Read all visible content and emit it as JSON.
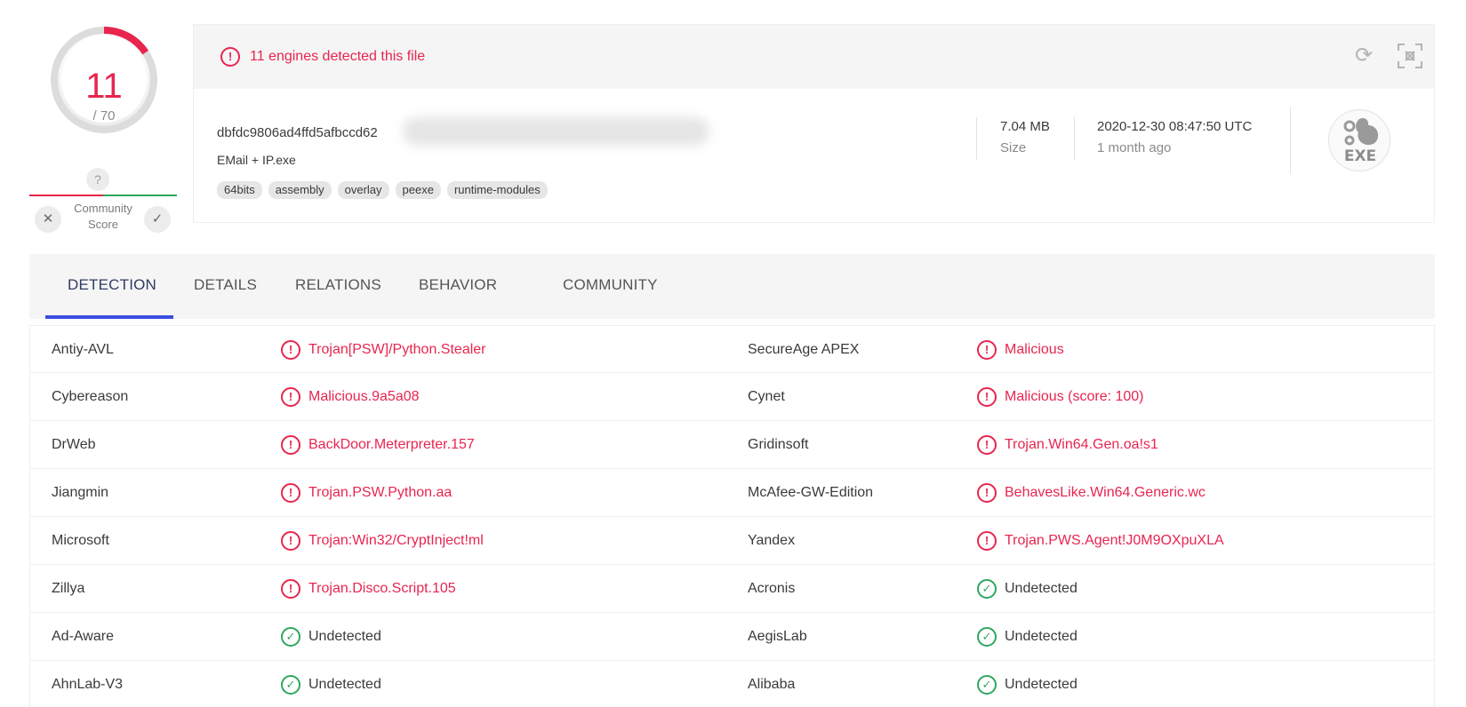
{
  "score": {
    "detected": "11",
    "total": "/ 70",
    "detected_fraction": 0.157,
    "community_question": "?",
    "community_label_1": "Community",
    "community_label_2": "Score",
    "vote_down": "✕",
    "vote_up": "✓"
  },
  "banner": {
    "alert_icon": "!",
    "message": "11 engines detected this file"
  },
  "file": {
    "hash_visible": "dbfdc9806ad4ffd5afbccd62",
    "name": "EMail + IP.exe",
    "tags": [
      "64bits",
      "assembly",
      "overlay",
      "peexe",
      "runtime-modules"
    ],
    "size_value": "7.04 MB",
    "size_label": "Size",
    "date_value": "2020-12-30 08:47:50 UTC",
    "date_relative": "1 month ago",
    "type_badge": "EXE"
  },
  "tabs": [
    "DETECTION",
    "DETAILS",
    "RELATIONS",
    "BEHAVIOR",
    "COMMUNITY"
  ],
  "colors": {
    "malicious": "#e8254f",
    "clean": "#2fa75e",
    "tab_accent": "#3b4de0"
  },
  "detections": [
    {
      "left": {
        "engine": "Antiy-AVL",
        "result": "Trojan[PSW]/Python.Stealer",
        "status": "malicious"
      },
      "right": {
        "engine": "SecureAge APEX",
        "result": "Malicious",
        "status": "malicious"
      }
    },
    {
      "left": {
        "engine": "Cybereason",
        "result": "Malicious.9a5a08",
        "status": "malicious"
      },
      "right": {
        "engine": "Cynet",
        "result": "Malicious (score: 100)",
        "status": "malicious"
      }
    },
    {
      "left": {
        "engine": "DrWeb",
        "result": "BackDoor.Meterpreter.157",
        "status": "malicious"
      },
      "right": {
        "engine": "Gridinsoft",
        "result": "Trojan.Win64.Gen.oa!s1",
        "status": "malicious"
      }
    },
    {
      "left": {
        "engine": "Jiangmin",
        "result": "Trojan.PSW.Python.aa",
        "status": "malicious"
      },
      "right": {
        "engine": "McAfee-GW-Edition",
        "result": "BehavesLike.Win64.Generic.wc",
        "status": "malicious"
      }
    },
    {
      "left": {
        "engine": "Microsoft",
        "result": "Trojan:Win32/CryptInject!ml",
        "status": "malicious"
      },
      "right": {
        "engine": "Yandex",
        "result": "Trojan.PWS.Agent!J0M9OXpuXLA",
        "status": "malicious"
      }
    },
    {
      "left": {
        "engine": "Zillya",
        "result": "Trojan.Disco.Script.105",
        "status": "malicious"
      },
      "right": {
        "engine": "Acronis",
        "result": "Undetected",
        "status": "undetected"
      }
    },
    {
      "left": {
        "engine": "Ad-Aware",
        "result": "Undetected",
        "status": "undetected"
      },
      "right": {
        "engine": "AegisLab",
        "result": "Undetected",
        "status": "undetected"
      }
    },
    {
      "left": {
        "engine": "AhnLab-V3",
        "result": "Undetected",
        "status": "undetected"
      },
      "right": {
        "engine": "Alibaba",
        "result": "Undetected",
        "status": "undetected"
      }
    }
  ]
}
